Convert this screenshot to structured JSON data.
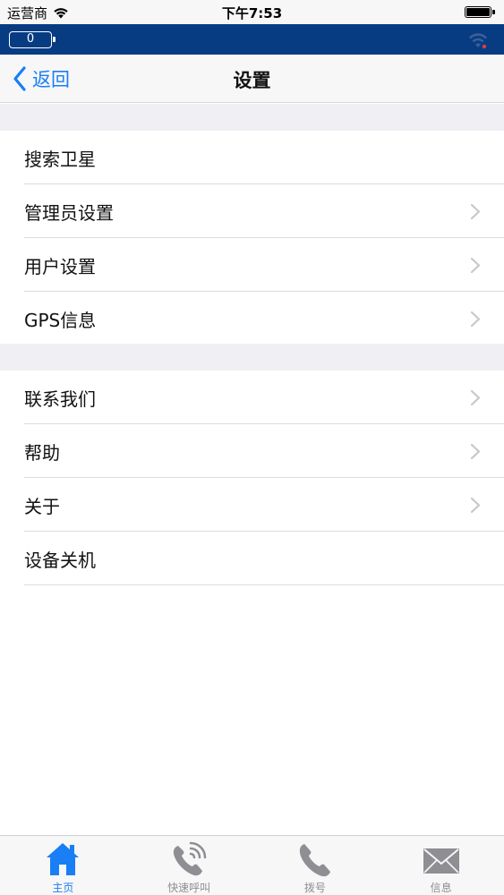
{
  "status_bar": {
    "carrier": "运营商",
    "time": "下午7:53"
  },
  "device_bar": {
    "battery_value": "0",
    "signal_icon": "wifi-signal-icon"
  },
  "nav": {
    "back_label": "返回",
    "title": "设置"
  },
  "sections": [
    {
      "items": [
        {
          "label": "搜索卫星",
          "has_chevron": false
        },
        {
          "label": "管理员设置",
          "has_chevron": true
        },
        {
          "label": "用户设置",
          "has_chevron": true
        },
        {
          "label": "GPS信息",
          "has_chevron": true
        }
      ]
    },
    {
      "items": [
        {
          "label": "联系我们",
          "has_chevron": true
        },
        {
          "label": "帮助",
          "has_chevron": true
        },
        {
          "label": "关于",
          "has_chevron": true
        },
        {
          "label": "设备关机",
          "has_chevron": false
        }
      ]
    }
  ],
  "tabs": [
    {
      "label": "主页",
      "icon": "home-icon",
      "active": true
    },
    {
      "label": "快速呼叫",
      "icon": "phone-ringing-icon",
      "active": false
    },
    {
      "label": "拨号",
      "icon": "phone-icon",
      "active": false
    },
    {
      "label": "信息",
      "icon": "envelope-icon",
      "active": false
    }
  ],
  "colors": {
    "accent": "#1a7ef5",
    "device_bar": "#073c83",
    "inactive_tab": "#8e8e93"
  }
}
